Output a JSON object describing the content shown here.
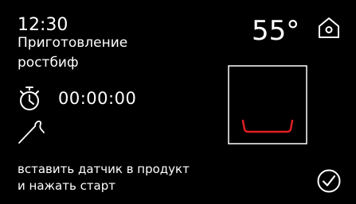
{
  "colors": {
    "background": "#000000",
    "foreground": "#ffffff",
    "heating_element": "#e01e24"
  },
  "status": {
    "time": "12:30"
  },
  "program": {
    "line1": "Приготовление",
    "line2": "ростбиф"
  },
  "temperature": {
    "value": "55°"
  },
  "timer": {
    "value": "00:00:00"
  },
  "instruction": {
    "line1": "вставить датчик в продукт",
    "line2": "и нажать старт"
  },
  "icons": {
    "home": "home-icon",
    "stopwatch": "stopwatch-icon",
    "probe": "meat-probe-icon",
    "confirm": "checkmark-icon",
    "oven": "oven-bottom-heat-icon"
  }
}
